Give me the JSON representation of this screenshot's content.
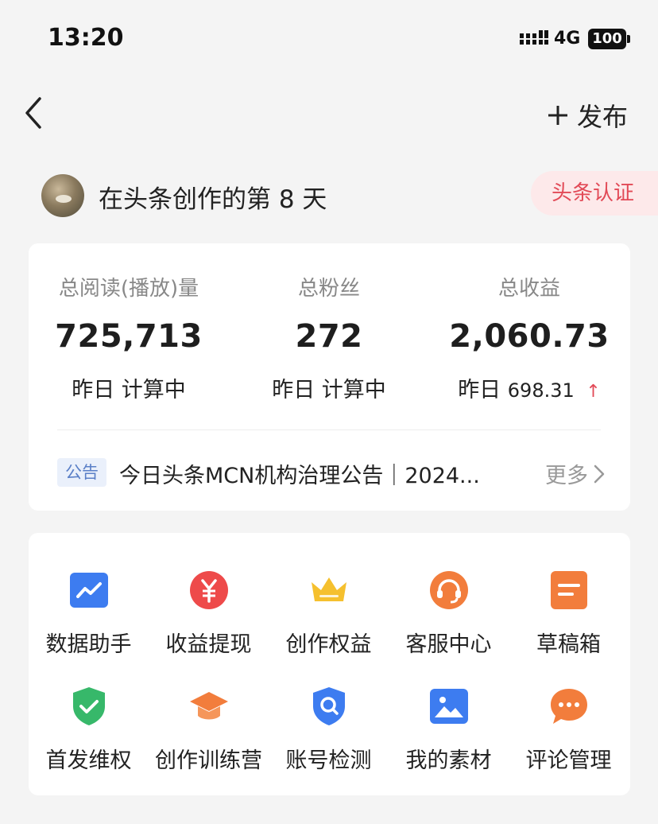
{
  "status_bar": {
    "time": "13:20",
    "network": "4G",
    "battery": "100"
  },
  "nav": {
    "publish_label": "发布"
  },
  "profile": {
    "text": "在头条创作的第 8 天",
    "badge": "头条认证"
  },
  "stats": [
    {
      "label": "总阅读(播放)量",
      "value": "725,713",
      "sub_prefix": "昨日",
      "sub_value": "计算中"
    },
    {
      "label": "总粉丝",
      "value": "272",
      "sub_prefix": "昨日",
      "sub_value": "计算中"
    },
    {
      "label": "总收益",
      "value": "2,060.73",
      "sub_prefix": "昨日",
      "sub_value": "698.31",
      "sub_trend": "up"
    }
  ],
  "notice": {
    "tag": "公告",
    "text": "今日头条MCN机构治理公告｜2024...",
    "more": "更多"
  },
  "tools": [
    {
      "label": "数据助手",
      "icon": "chart-icon",
      "color": "#3d7cf0"
    },
    {
      "label": "收益提现",
      "icon": "yuan-icon",
      "color": "#ee4a4a"
    },
    {
      "label": "创作权益",
      "icon": "crown-icon",
      "color": "#f5c02e"
    },
    {
      "label": "客服中心",
      "icon": "headset-icon",
      "color": "#f27d3c"
    },
    {
      "label": "草稿箱",
      "icon": "draft-icon",
      "color": "#f27d3c"
    },
    {
      "label": "首发维权",
      "icon": "shield-check-icon",
      "color": "#37b86a"
    },
    {
      "label": "创作训练营",
      "icon": "graduation-cap-icon",
      "color": "#f27d3c"
    },
    {
      "label": "账号检测",
      "icon": "search-shield-icon",
      "color": "#3d7cf0"
    },
    {
      "label": "我的素材",
      "icon": "image-icon",
      "color": "#3d7cf0"
    },
    {
      "label": "评论管理",
      "icon": "comment-icon",
      "color": "#f27d3c"
    }
  ]
}
